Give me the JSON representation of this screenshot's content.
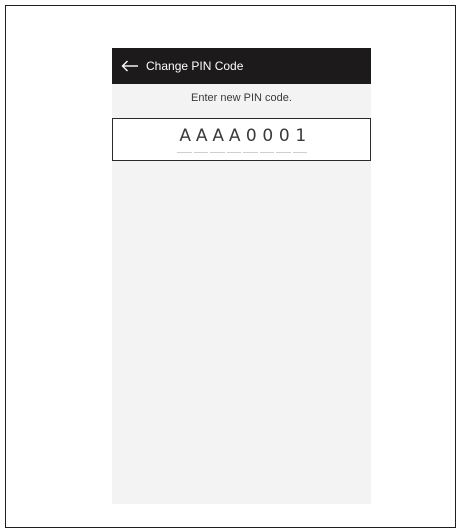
{
  "header": {
    "back_icon": "arrow-left-icon",
    "title": "Change PIN Code"
  },
  "prompt": "Enter new PIN code.",
  "pin": {
    "chars": [
      "A",
      "A",
      "A",
      "A",
      "0",
      "0",
      "0",
      "1"
    ],
    "max_length": 8
  },
  "colors": {
    "app_bar": "#1c1a1a",
    "screen_bg": "#f3f3f3",
    "pin_box_border": "#2a2a2a",
    "text": "#3a3a3a",
    "underline": "#cfcfcf"
  }
}
